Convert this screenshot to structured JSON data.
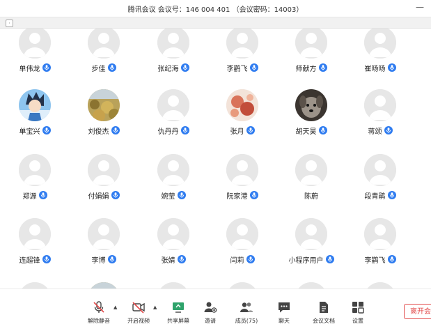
{
  "window": {
    "title": "腾讯会议  会议号：146 004 401  （会议密码：14003）",
    "minimize_symbol": "—"
  },
  "colors": {
    "accent": "#2f7cf0",
    "danger": "#e24b4b",
    "avatar_bg": "#e7e7e7"
  },
  "participants": [
    {
      "name": "单伟龙",
      "mic": true,
      "avatar": "default"
    },
    {
      "name": "步佳",
      "mic": true,
      "avatar": "default"
    },
    {
      "name": "张纪海",
      "mic": true,
      "avatar": "default"
    },
    {
      "name": "李鹳飞",
      "mic": true,
      "avatar": "default"
    },
    {
      "name": "师献方",
      "mic": true,
      "avatar": "default"
    },
    {
      "name": "崔旸旸",
      "mic": true,
      "avatar": "default"
    },
    {
      "name": "单宝兴",
      "mic": true,
      "avatar": "anime"
    },
    {
      "name": "刘俊杰",
      "mic": true,
      "avatar": "leaves"
    },
    {
      "name": "仇丹丹",
      "mic": true,
      "avatar": "default"
    },
    {
      "name": "张月",
      "mic": true,
      "avatar": "flowers"
    },
    {
      "name": "胡天昊",
      "mic": true,
      "avatar": "dog"
    },
    {
      "name": "蒋颂",
      "mic": true,
      "avatar": "default"
    },
    {
      "name": "郑源",
      "mic": true,
      "avatar": "default"
    },
    {
      "name": "付娟娟",
      "mic": true,
      "avatar": "default"
    },
    {
      "name": "婉莹",
      "mic": true,
      "avatar": "default"
    },
    {
      "name": "阮家港",
      "mic": true,
      "avatar": "default"
    },
    {
      "name": "陈蔚",
      "mic": false,
      "avatar": "default"
    },
    {
      "name": "段青鹃",
      "mic": true,
      "avatar": "default"
    },
    {
      "name": "连超锋",
      "mic": true,
      "avatar": "default"
    },
    {
      "name": "李博",
      "mic": true,
      "avatar": "default"
    },
    {
      "name": "张婧",
      "mic": true,
      "avatar": "default"
    },
    {
      "name": "闫莉",
      "mic": true,
      "avatar": "default"
    },
    {
      "name": "小程序用户",
      "mic": true,
      "avatar": "default"
    },
    {
      "name": "李鹳飞",
      "mic": true,
      "avatar": "default"
    },
    {
      "name": "",
      "mic": false,
      "avatar": "default"
    },
    {
      "name": "",
      "mic": false,
      "avatar": "leaves"
    },
    {
      "name": "",
      "mic": false,
      "avatar": "default"
    },
    {
      "name": "",
      "mic": false,
      "avatar": "default"
    },
    {
      "name": "",
      "mic": false,
      "avatar": "default"
    },
    {
      "name": "",
      "mic": false,
      "avatar": "default"
    }
  ],
  "toolbar": {
    "unmute": "解除静音",
    "start_video": "开启视频",
    "share_screen": "共享屏幕",
    "invite": "邀请",
    "members": "成员(75)",
    "chat": "聊天",
    "meeting_docs": "会议文档",
    "settings": "设置",
    "leave": "离开会议"
  }
}
